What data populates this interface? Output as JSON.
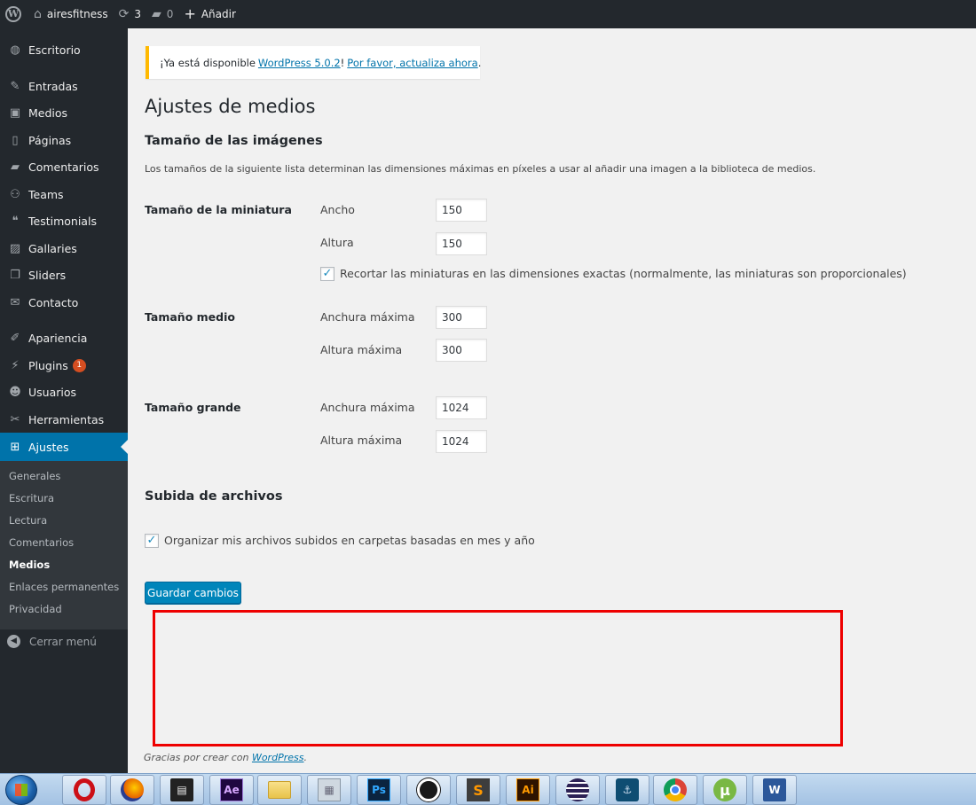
{
  "adminbar": {
    "site_name": "airesfitness",
    "updates_count": "3",
    "comments_count": "0",
    "add_new_label": "Añadir"
  },
  "sidebar": {
    "items": [
      {
        "label": "Escritorio",
        "icon": "dashboard-icon"
      },
      {
        "label": "Entradas",
        "icon": "pin-icon"
      },
      {
        "label": "Medios",
        "icon": "media-icon"
      },
      {
        "label": "Páginas",
        "icon": "page-icon"
      },
      {
        "label": "Comentarios",
        "icon": "comment-icon"
      },
      {
        "label": "Teams",
        "icon": "groups-icon"
      },
      {
        "label": "Testimonials",
        "icon": "testimonial-icon"
      },
      {
        "label": "Gallaries",
        "icon": "gallery-icon"
      },
      {
        "label": "Sliders",
        "icon": "slides-icon"
      },
      {
        "label": "Contacto",
        "icon": "email-icon"
      },
      {
        "label": "Apariencia",
        "icon": "appearance-icon"
      },
      {
        "label": "Plugins",
        "icon": "plugins-icon",
        "badge": "1"
      },
      {
        "label": "Usuarios",
        "icon": "users-icon"
      },
      {
        "label": "Herramientas",
        "icon": "tools-icon"
      },
      {
        "label": "Ajustes",
        "icon": "settings-icon",
        "active": true
      }
    ],
    "submenu": [
      "Generales",
      "Escritura",
      "Lectura",
      "Comentarios",
      "Medios",
      "Enlaces permanentes",
      "Privacidad"
    ],
    "submenu_current": "Medios",
    "collapse_label": "Cerrar menú"
  },
  "notice": {
    "prefix": "¡Ya está disponible",
    "link1": "WordPress 5.0.2",
    "mid": "!",
    "link2": "Por favor, actualiza ahora",
    "suffix": "."
  },
  "page": {
    "title": "Ajustes de medios",
    "section_images": "Tamaño de las imágenes",
    "images_desc": "Los tamaños de la siguiente lista determinan las dimensiones máximas en píxeles a usar al añadir una imagen a la biblioteca de medios.",
    "thumbnail": {
      "heading": "Tamaño de la miniatura",
      "width_label": "Ancho",
      "width_value": "150",
      "height_label": "Altura",
      "height_value": "150",
      "crop_label": "Recortar las miniaturas en las dimensiones exactas (normalmente, las miniaturas son proporcionales)",
      "crop_checked": true
    },
    "medium": {
      "heading": "Tamaño medio",
      "width_label": "Anchura máxima",
      "width_value": "300",
      "height_label": "Altura máxima",
      "height_value": "300"
    },
    "large": {
      "heading": "Tamaño grande",
      "width_label": "Anchura máxima",
      "width_value": "1024",
      "height_label": "Altura máxima",
      "height_value": "1024"
    },
    "section_uploads": "Subida de archivos",
    "uploads_label": "Organizar mis archivos subidos en carpetas basadas en mes y año",
    "uploads_checked": true,
    "save_label": "Guardar cambios"
  },
  "footer": {
    "text": "Gracias por crear con",
    "link": "WordPress",
    "suffix": "."
  },
  "taskbar": {
    "apps": [
      {
        "name": "opera-icon",
        "glyph": "",
        "color": "#cc0f16"
      },
      {
        "name": "firefox-icon",
        "glyph": "",
        "color": "#e66000"
      },
      {
        "name": "media-player-icon",
        "glyph": "▤",
        "color": "#222222"
      },
      {
        "name": "after-effects-icon",
        "glyph": "Ae",
        "color": "#1f0740"
      },
      {
        "name": "file-explorer-icon",
        "glyph": "",
        "color": "#e8c34a"
      },
      {
        "name": "calculator-icon",
        "glyph": "▦",
        "color": "#cfd8e0"
      },
      {
        "name": "photoshop-icon",
        "glyph": "Ps",
        "color": "#0b2440"
      },
      {
        "name": "inkscape-icon",
        "glyph": "",
        "color": "#1a1a1a"
      },
      {
        "name": "sublime-text-icon",
        "glyph": "S",
        "color": "#ff9800"
      },
      {
        "name": "illustrator-icon",
        "glyph": "Ai",
        "color": "#2e1300"
      },
      {
        "name": "eclipse-icon",
        "glyph": "",
        "color": "#2c2255"
      },
      {
        "name": "mysql-workbench-icon",
        "glyph": "",
        "color": "#0e4d72"
      },
      {
        "name": "chrome-icon",
        "glyph": "",
        "color": "#db4437"
      },
      {
        "name": "utorrent-icon",
        "glyph": "µ",
        "color": "#79b844"
      },
      {
        "name": "word-icon",
        "glyph": "W",
        "color": "#2b579a"
      }
    ]
  }
}
